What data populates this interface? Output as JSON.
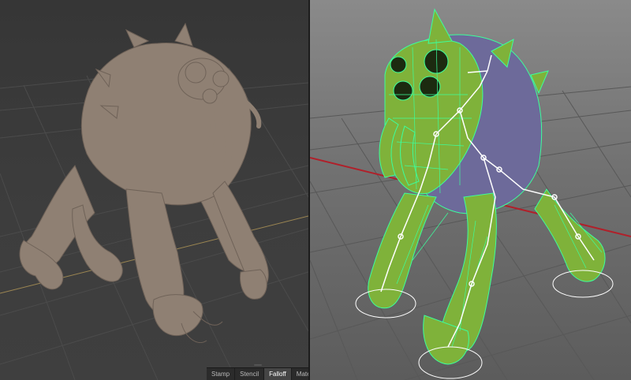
{
  "left_viewport": {
    "mode": "sculpt",
    "model_color": "#8f8073",
    "grid_color": "#4a4a4a",
    "axis_color": "#a08a5a"
  },
  "right_viewport": {
    "mode": "wireframe-on-shaded with skeleton",
    "body_color": "#7fb23a",
    "back_color": "#6d6a9a",
    "wire_color": "#3cff9c",
    "bone_color": "#ffffff",
    "axis_color": "#b0202a"
  },
  "tool_tabs": [
    {
      "label": "Stamp",
      "active": false
    },
    {
      "label": "Stencil",
      "active": false
    },
    {
      "label": "Falloff",
      "active": true
    },
    {
      "label": "Materi",
      "active": false
    }
  ]
}
